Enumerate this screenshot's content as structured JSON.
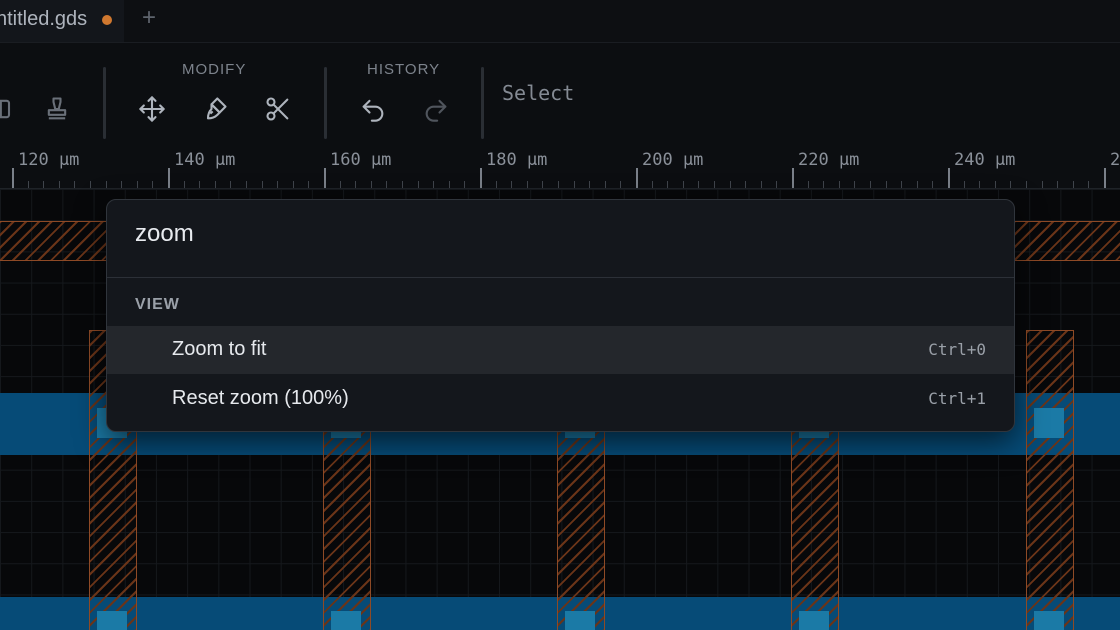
{
  "tab": {
    "title": "ntitled.gds",
    "add_label": "+"
  },
  "toolbar": {
    "modify_label": "MODIFY",
    "history_label": "HISTORY",
    "mode_label": "Select",
    "tools": {
      "left_partial": "layers-icon",
      "stamp": "stamp-icon",
      "move": "move-icon",
      "paint": "brush-icon",
      "cut": "scissors-icon",
      "undo": "undo-icon",
      "redo": "redo-icon"
    }
  },
  "ruler": {
    "labels": [
      "120 µm",
      "140 µm",
      "160 µm",
      "180 µm",
      "200 µm",
      "220 µm",
      "240 µm",
      "2"
    ]
  },
  "palette": {
    "query": "zoom",
    "section": "VIEW",
    "commands": [
      {
        "label": "Zoom to fit",
        "shortcut": "Ctrl+0"
      },
      {
        "label": "Reset zoom (100%)",
        "shortcut": "Ctrl+1"
      }
    ]
  },
  "colors": {
    "unsaved_dot": "#d0782f",
    "poly_hatch": "#8e4a26",
    "metal": "#064b77",
    "via": "#1b7aa6"
  }
}
